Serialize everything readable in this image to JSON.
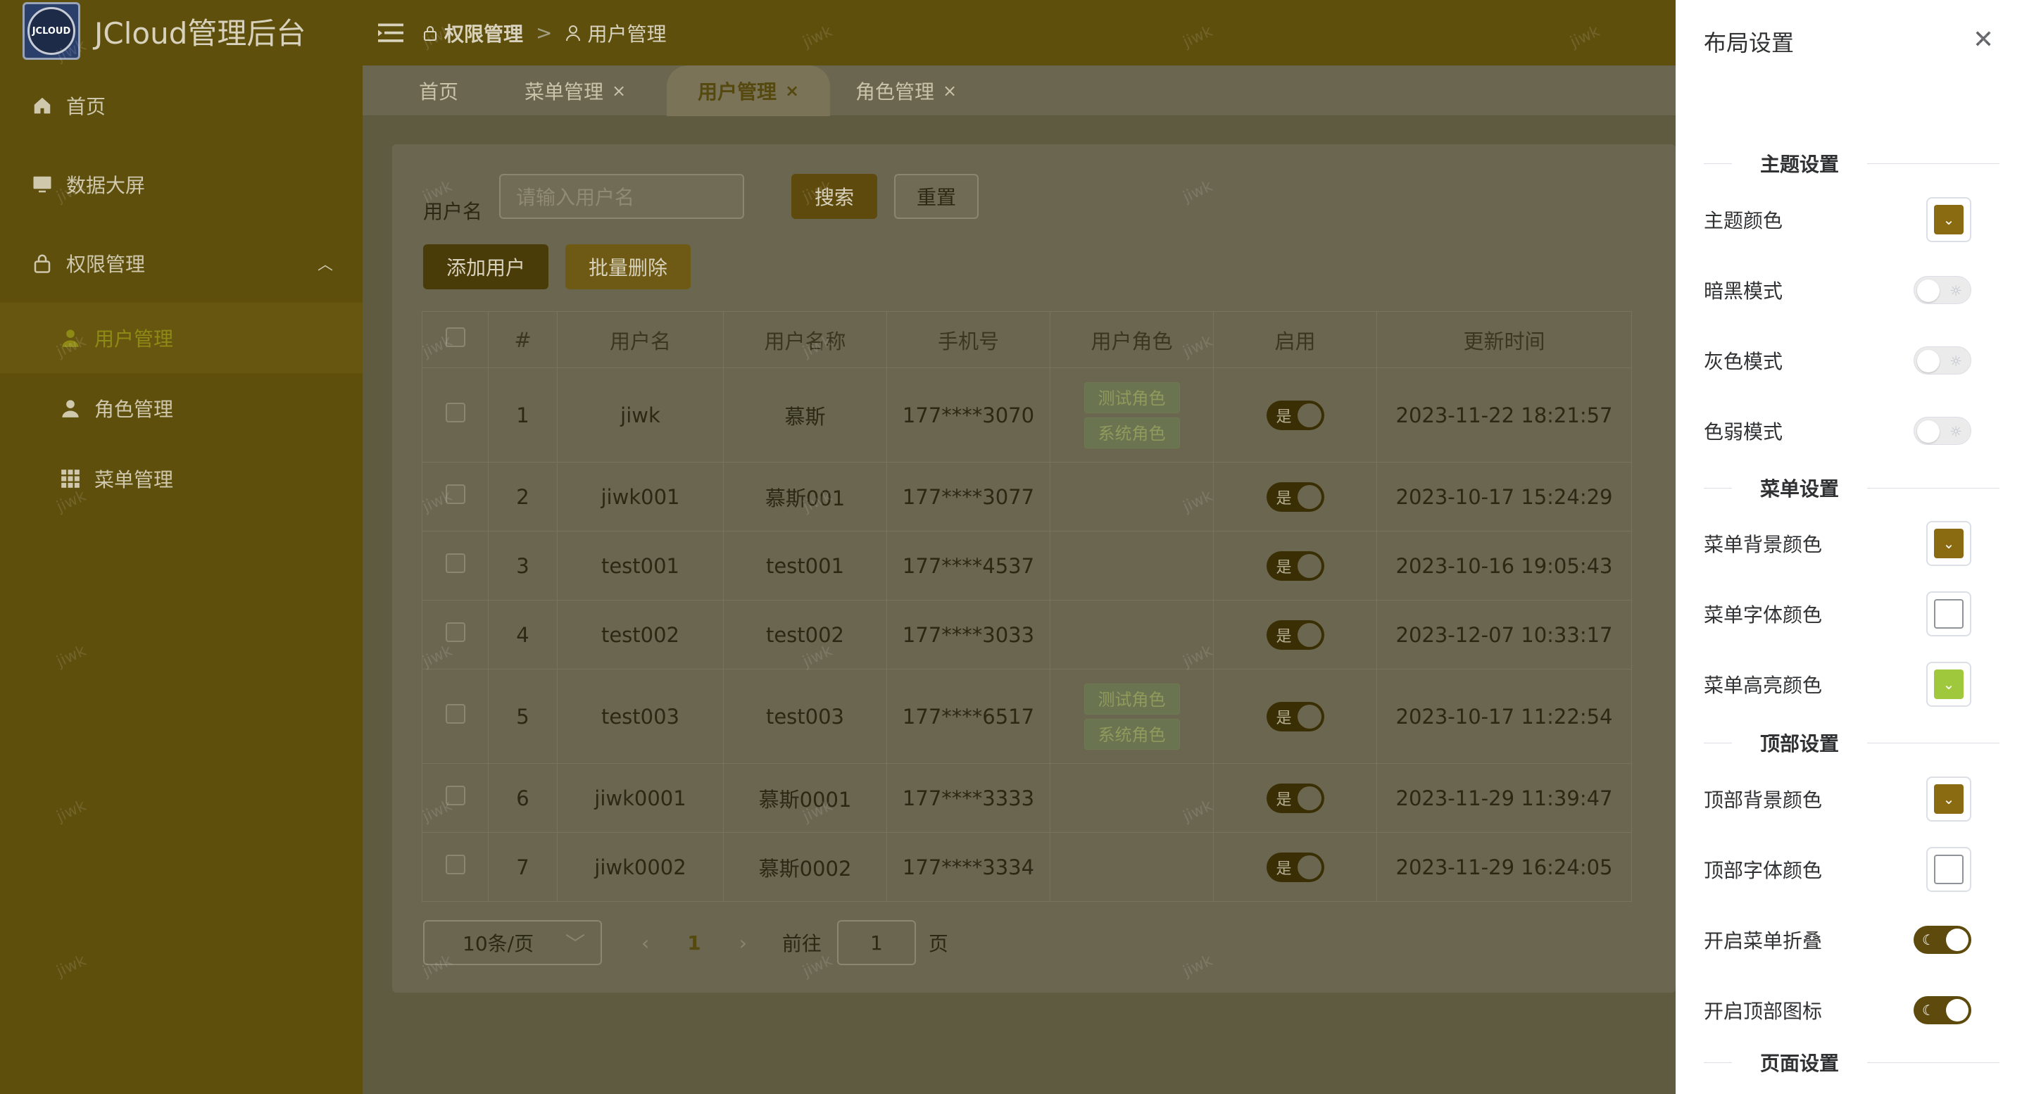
{
  "app": {
    "title": "JCloud管理后台",
    "logo_text": "JCLOUD"
  },
  "sidebar": {
    "items": [
      {
        "label": "首页",
        "icon": "home-icon"
      },
      {
        "label": "数据大屏",
        "icon": "monitor-icon"
      },
      {
        "label": "权限管理",
        "icon": "lock-icon"
      },
      {
        "label": "用户管理",
        "icon": "user-icon"
      },
      {
        "label": "角色管理",
        "icon": "user-icon"
      },
      {
        "label": "菜单管理",
        "icon": "grid-icon"
      }
    ]
  },
  "header": {
    "breadcrumb": [
      "权限管理",
      "用户管理"
    ],
    "breadcrumb_sep": ">"
  },
  "tabs": [
    "首页",
    "菜单管理",
    "用户管理",
    "角色管理"
  ],
  "search": {
    "label": "用户名",
    "placeholder": "请输入用户名",
    "search_btn": "搜索",
    "reset_btn": "重置"
  },
  "toolbar": {
    "add_btn": "添加用户",
    "batch_delete_btn": "批量删除"
  },
  "table": {
    "columns": [
      "#",
      "用户名",
      "用户名称",
      "手机号",
      "用户角色",
      "启用",
      "更新时间"
    ],
    "rows": [
      {
        "idx": "1",
        "username": "jiwk",
        "name": "慕斯",
        "phone": "177****3070",
        "roles": [
          "测试角色",
          "系统角色"
        ],
        "enabled": "是",
        "updated": "2023-11-22 18:21:57"
      },
      {
        "idx": "2",
        "username": "jiwk001",
        "name": "慕斯001",
        "phone": "177****3077",
        "roles": [],
        "enabled": "是",
        "updated": "2023-10-17 15:24:29"
      },
      {
        "idx": "3",
        "username": "test001",
        "name": "test001",
        "phone": "177****4537",
        "roles": [],
        "enabled": "是",
        "updated": "2023-10-16 19:05:43"
      },
      {
        "idx": "4",
        "username": "test002",
        "name": "test002",
        "phone": "177****3033",
        "roles": [],
        "enabled": "是",
        "updated": "2023-12-07 10:33:17"
      },
      {
        "idx": "5",
        "username": "test003",
        "name": "test003",
        "phone": "177****6517",
        "roles": [
          "测试角色",
          "系统角色"
        ],
        "enabled": "是",
        "updated": "2023-10-17 11:22:54"
      },
      {
        "idx": "6",
        "username": "jiwk0001",
        "name": "慕斯0001",
        "phone": "177****3333",
        "roles": [],
        "enabled": "是",
        "updated": "2023-11-29 11:39:47"
      },
      {
        "idx": "7",
        "username": "jiwk0002",
        "name": "慕斯0002",
        "phone": "177****3334",
        "roles": [],
        "enabled": "是",
        "updated": "2023-11-29 16:24:05"
      }
    ]
  },
  "pager": {
    "page_size": "10条/页",
    "current": "1",
    "goto_label": "前往",
    "goto_value": "1",
    "page_suffix": "页"
  },
  "drawer": {
    "title": "布局设置",
    "sections": {
      "theme": "主题设置",
      "menu": "菜单设置",
      "top": "顶部设置",
      "page": "页面设置"
    },
    "rows": {
      "theme_color": "主题颜色",
      "dark_mode": "暗黑模式",
      "gray_mode": "灰色模式",
      "weak_mode": "色弱模式",
      "menu_bg": "菜单背景颜色",
      "menu_font": "菜单字体颜色",
      "menu_highlight": "菜单高亮颜色",
      "top_bg": "顶部背景颜色",
      "top_font": "顶部字体颜色",
      "menu_collapse": "开启菜单折叠",
      "top_icon": "开启顶部图标"
    },
    "colors": {
      "theme_color": "#8b6b12",
      "menu_bg": "#8b6b12",
      "menu_highlight": "#a0c83c",
      "top_bg": "#8b6b12"
    }
  },
  "watermark": "jiwk"
}
